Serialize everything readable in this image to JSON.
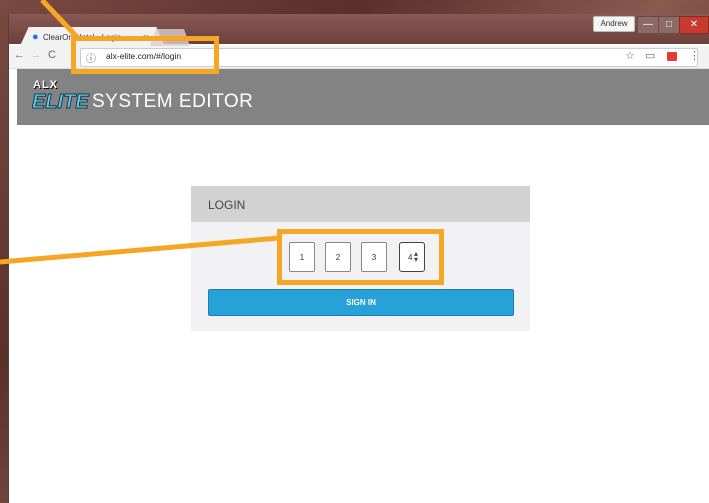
{
  "browser": {
    "tab_title": "ClearOne Intel - Login",
    "tab_close": "×",
    "user_badge": "Andrew",
    "url": "alx-elite.com/#/login",
    "info_glyph": "ⓘ",
    "back_glyph": "←",
    "forward_glyph": "→",
    "reload_glyph": "C",
    "star_glyph": "☆",
    "cast_glyph": "▭",
    "menu_glyph": "⋮",
    "min_glyph": "—",
    "max_glyph": "□",
    "close_glyph": "✕"
  },
  "app": {
    "logo_top": "ALX",
    "logo_main": "ELITE",
    "title": "SYSTEM EDITOR"
  },
  "login": {
    "heading": "LOGIN",
    "digits": [
      "1",
      "2",
      "3",
      "4"
    ],
    "spinner_glyph": "▴▾",
    "sign_in_label": "SIGN IN"
  },
  "colors": {
    "accent": "#27a2d8",
    "annotation": "#f5a623",
    "header_bg": "#838383"
  }
}
